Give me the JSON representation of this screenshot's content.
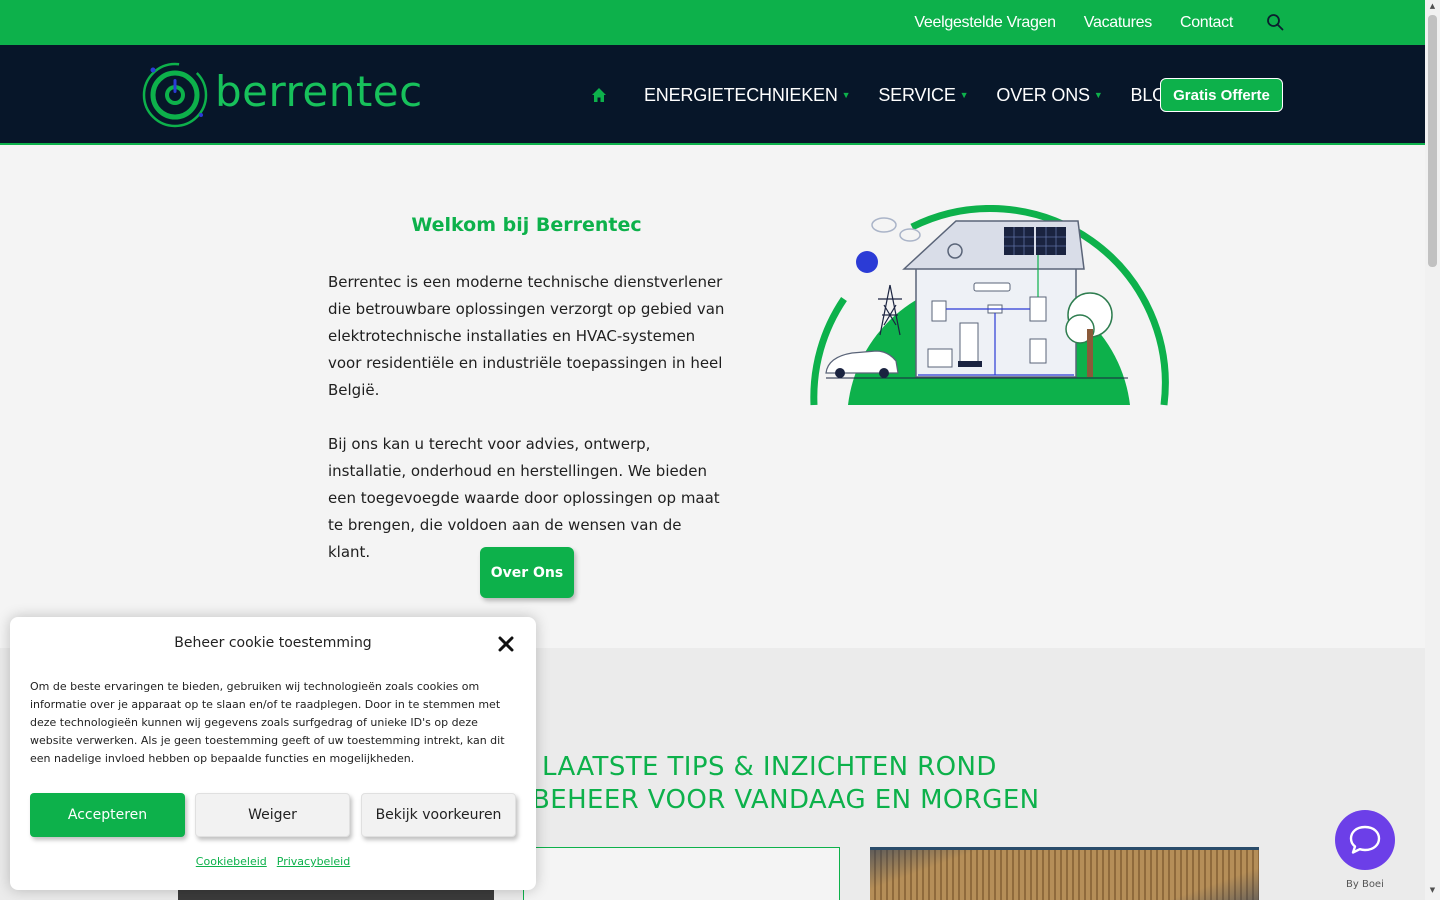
{
  "topbar": {
    "links": [
      "Veelgestelde Vragen",
      "Vacatures",
      "Contact"
    ],
    "search_icon": "search-icon"
  },
  "header": {
    "logo_text": "berrentec",
    "nav": [
      {
        "label": "ENERGIETECHNIEKEN",
        "has_dropdown": true
      },
      {
        "label": "SERVICE",
        "has_dropdown": true
      },
      {
        "label": "OVER ONS",
        "has_dropdown": true
      },
      {
        "label": "BLOG / NIEUWS",
        "has_dropdown": false
      }
    ],
    "cta_label": "Gratis Offerte"
  },
  "hero": {
    "title": "Welkom bij Berrentec",
    "paragraph1": "Berrentec is een moderne technische dienstverlener die betrouwbare oplossingen verzorgt op gebied van elektrotechnische installaties en HVAC-systemen voor residentiële en industriële toepassingen in heel België.",
    "paragraph2": "Bij ons kan u terecht voor advies, ontwerp, installatie, onderhoud en herstellingen. We bieden een toegevoegde waarde door oplossingen op maat te brengen, die voldoen aan de wensen van de klant.",
    "button_label": "Over Ons"
  },
  "blog": {
    "title_line1": "LAATSTE TIPS & INZICHTEN ROND",
    "title_line2": "BEHEER VOOR VANDAAG EN MORGEN"
  },
  "cookie": {
    "title": "Beheer cookie toestemming",
    "text": "Om de beste ervaringen te bieden, gebruiken wij technologieën zoals cookies om informatie over je apparaat op te slaan en/of te raadplegen. Door in te stemmen met deze technologieën kunnen wij gegevens zoals surfgedrag of unieke ID's op deze website verwerken. Als je geen toestemming geeft of uw toestemming intrekt, kan dit een nadelige invloed hebben op bepaalde functies en mogelijkheden.",
    "accept_label": "Accepteren",
    "deny_label": "Weiger",
    "prefs_label": "Bekijk voorkeuren",
    "link1": "Cookiebeleid",
    "link2": "Privacybeleid"
  },
  "chat": {
    "by_label": "By Boei"
  },
  "colors": {
    "brand_green": "#0db14b",
    "header_navy": "#071629",
    "chat_purple": "#6c3fe8"
  }
}
